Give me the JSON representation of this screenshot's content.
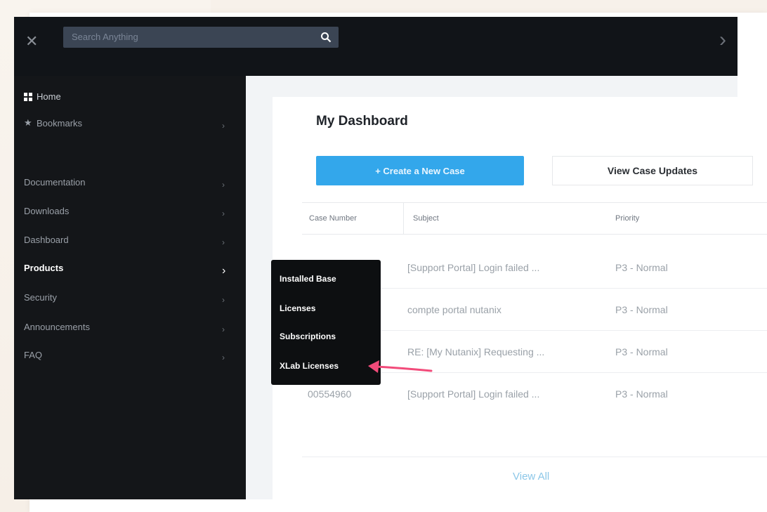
{
  "colors": {
    "accent": "#33a7eb",
    "sidebar_bg": "#141619",
    "arrow": "#f24b7a"
  },
  "topbar": {
    "close_icon": "close-icon",
    "search": {
      "placeholder": "Search Anything",
      "icon": "search-icon"
    },
    "right_icon": "chevron-right-icon"
  },
  "sidebar": {
    "items": [
      {
        "label": "Home",
        "icon": "grid-icon"
      },
      {
        "label": "Bookmarks",
        "icon": "star-icon"
      },
      {
        "label": "Documentation"
      },
      {
        "label": "Downloads"
      },
      {
        "label": "Dashboard"
      },
      {
        "label": "Products"
      },
      {
        "label": "Security"
      },
      {
        "label": "Announcements"
      },
      {
        "label": "FAQ"
      }
    ]
  },
  "submenu": {
    "items": [
      "Installed Base",
      "Licenses",
      "Subscriptions",
      "XLab Licenses"
    ]
  },
  "main": {
    "title": "My Dashboard",
    "buttons": {
      "new_case": "+ Create a New Case",
      "view_updates": "View Case Updates"
    },
    "table": {
      "headers": [
        "Case Number",
        "Subject",
        "Priority"
      ],
      "rows": [
        {
          "case": "",
          "subject": "[Support Portal] Login failed ...",
          "priority": "P3 - Normal"
        },
        {
          "case": "",
          "subject": "compte portal nutanix",
          "priority": "P3 - Normal"
        },
        {
          "case": "",
          "subject": "RE: [My Nutanix] Requesting ...",
          "priority": "P3 - Normal"
        },
        {
          "case": "00554960",
          "subject": "[Support Portal] Login failed ...",
          "priority": "P3 - Normal"
        }
      ]
    },
    "view_all": "View All"
  }
}
